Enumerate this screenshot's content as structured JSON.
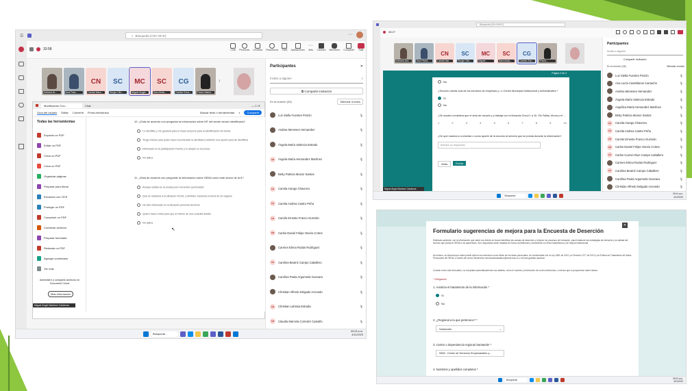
{
  "slide": {
    "accent_colors": [
      "#8dc63f",
      "#5a8f29",
      "#a9d76a"
    ]
  },
  "teams_call": {
    "search_placeholder": "Búsqueda (Ctrl+Alt+E)",
    "meeting_time": "33:58",
    "toolbar": {
      "chat": "Chat",
      "people": "Personas",
      "raise": "Levantar",
      "react": "Reaccionar",
      "view": "Vista",
      "apps": "Aplicaciones",
      "more": "Más",
      "camera": "Cámara",
      "mic": "Micrófono",
      "share": "Compartir",
      "leave": "Salir"
    },
    "tiles": [
      {
        "kind": "photo",
        "label": "Adriana Ar..."
      },
      {
        "kind": "photo",
        "label": "Ana Paul..."
      },
      {
        "initials": "CN",
        "label": "Camila Nara...",
        "bg": "#f7d6d2",
        "fg": "#a4262c"
      },
      {
        "initials": "SC",
        "label": "Sergio Cifu...",
        "bg": "#d9e6f5",
        "fg": "#2f5f98"
      },
      {
        "initials": "MC",
        "label": "Miguel Ángel M...",
        "bg": "#f4d8dc",
        "fg": "#a4262c"
      },
      {
        "initials": "SC",
        "label": "Sara Arias...",
        "bg": "#f7d6d2",
        "fg": "#a4262c"
      },
      {
        "initials": "CG",
        "label": "Camila Gonz...",
        "bg": "#d9e6f5",
        "fg": "#2f5f98"
      },
      {
        "kind": "photo",
        "label": "Paula Valent..."
      }
    ],
    "browser_tab": "Modificación Con...",
    "browser_tab2": "Chat",
    "pdf_menu": [
      "Guía del usuario",
      "Editar",
      "Convertir",
      "Firma electrónica"
    ],
    "pdf_search": "Buscar texto o herramientas",
    "pdf_share": "Compartir",
    "tools_title": "Todas las herramientas",
    "tools": [
      {
        "label": "Exportar un PDF",
        "color": "#c0392b"
      },
      {
        "label": "Editar un PDF",
        "color": "#8e44ad"
      },
      {
        "label": "Crear un PDF",
        "color": "#c0392b"
      },
      {
        "label": "Crear un PDF",
        "color": "#e74c3c"
      },
      {
        "label": "Organizar páginas",
        "color": "#27ae60"
      },
      {
        "label": "Preparar para firmar",
        "color": "#8e44ad"
      },
      {
        "label": "Escanear con OCR",
        "color": "#2980b9"
      },
      {
        "label": "Proteger un PDF",
        "color": "#2980b9"
      },
      {
        "label": "Comprimir un PDF",
        "color": "#c0392b"
      },
      {
        "label": "Combinar archivos",
        "color": "#d35400"
      },
      {
        "label": "Preparar formulario",
        "color": "#8e44ad"
      },
      {
        "label": "Redactar un PDF",
        "color": "#c0392b"
      },
      {
        "label": "Agregar comentario",
        "color": "#16a085"
      },
      {
        "label": "Ver más",
        "color": "#7f8c8d"
      }
    ],
    "upsell_text": "Administre y comparta archivos en Document Cloud",
    "more_info": "Más información",
    "presenter": "Miguel Ángel Martínez Cárdenas",
    "q1": "10. ¿Está de acuerdo con preguntar la información sobre MT del sector sector identificado?",
    "q1_options": [
      "Lo identifico y me gustaría para el mejor proyecto para la identificación de fuente",
      "Tengo interés para poder hacer recomendar la identidad y también una opción para de identificar",
      "Interesado en la participación Fuente y lo adopto no reconoce",
      "No aplica"
    ],
    "q2": "11. ¿Está de acuerdo con preguntar la información sobre SENA como este sector de la 6?",
    "q2_options": [
      "Aunque estaba en la escasa pero ha tenido oportunidad",
      "Que se relaciona a la situación SCGS, y también, haciendo el tema de los lugares",
      "He sido interesado en la situación personal del tema",
      "Quiero hacer entrar para que el interés de una consulta detalle",
      "No aplica"
    ],
    "participants_title": "Participantes",
    "invite_placeholder": "Invitar a alguien",
    "share_invite": "Compartir invitación",
    "in_meeting": "En la reunión (34)",
    "mute_all": "Silenciar a todos",
    "participants": [
      {
        "name": "Luz Stella Fuentes Pinzón",
        "photo": true
      },
      {
        "name": "Andrea Meneses Hernandez",
        "photo": true
      },
      {
        "name": "Ángela María Valencia Estrada",
        "photo": true
      },
      {
        "initials": "AH",
        "name": "Ángela María Hernandez Martínez"
      },
      {
        "name": "Betty Patricia Munoz Santos",
        "photo": true
      },
      {
        "initials": "CA",
        "name": "Camila Arango Chaverra"
      },
      {
        "initials": "CA",
        "name": "Camila Andrea Castro Peña"
      },
      {
        "initials": "CG",
        "name": "Camilo Ernesto Franco Guzmán"
      },
      {
        "initials": "CD",
        "name": "Carlos Daniel Felipe Osorio Cortes"
      },
      {
        "name": "Carmen Elena Rodas Rodríguez",
        "photo": true
      },
      {
        "initials": "CC",
        "name": "Carolina Beatriz Campo Caballero"
      },
      {
        "name": "Carolina Paola Argumedo Guevara",
        "photo": true
      },
      {
        "name": "Christian Alfredo Delgado Acevedo",
        "photo": true
      },
      {
        "initials": "CE",
        "name": "Christian Lahissa Estrada"
      },
      {
        "initials": "CD",
        "name": "Claudia Marcela Corredor Castaño"
      }
    ],
    "taskbar_search": "Búsqueda",
    "clock_time": "09:03 a.m.",
    "clock_date": "4/11/2023"
  },
  "teams_form": {
    "search_placeholder": "Búsqueda (Ctrl+Alt+E)",
    "meeting_time": "48:27",
    "tiles": [
      {
        "kind": "photo",
        "label": "Adriana Arango..."
      },
      {
        "kind": "photo",
        "label": "Ana Paula..."
      },
      {
        "initials": "CN",
        "label": "Camila Nara...",
        "bg": "#f7d6d2",
        "fg": "#a4262c"
      },
      {
        "initials": "SC",
        "label": "Sergio Cifu...",
        "bg": "#d9e6f5",
        "fg": "#2f5f98"
      },
      {
        "initials": "MC",
        "label": "Miguel...",
        "bg": "#f4d8dc",
        "fg": "#a4262c"
      },
      {
        "initials": "SC",
        "label": "Sara Arias...",
        "bg": "#f7d6d2",
        "fg": "#a4262c"
      },
      {
        "initials": "CG",
        "label": "Camila Gonzalez...",
        "bg": "#d9e6f5",
        "fg": "#2f5f98"
      },
      {
        "kind": "photo",
        "label": "Paula..."
      }
    ],
    "q_autoriza_opt": "Sí",
    "q_sector": "¿Sección cuenta cuál de los servicios de empresas y / o Centro Municipal Institucional y Administrativo *",
    "q_sector_opt": "Sí",
    "q_regional": "¿Se usuario considera que el área de usuario y y trabaja con el Amanda Cloud 1 a 10, Sin Fallas, Ahora y el Satisfecho, ahora?",
    "scale_numbers": [
      "1",
      "2",
      "3",
      "4",
      "5",
      "6",
      "7",
      "8",
      "9",
      "10"
    ],
    "q_comment": "¿De qué manera sí comentar o como aporte de la sección al servicio que se presta durante la información?",
    "comment_placeholder": "Escriba su respuesta",
    "back_btn": "Atrás",
    "next_btn": "Enviar",
    "page_label": "Página 3 de 3",
    "presenter": "Miguel Ángel Martínez Cárdenas",
    "participants_title": "Participantes",
    "invite_placeholder": "Invitar a alguien",
    "share_invite": "Compartir invitación",
    "in_meeting": "En la reunión (35)",
    "mute_all": "Silenciar a todos",
    "participants": [
      {
        "name": "Luz Stella Fuentes Pinzón",
        "photo": true
      },
      {
        "name": "Ana Lucía Castellanos Camacho",
        "photo": true
      },
      {
        "name": "Andrea Meneses Hernandez",
        "photo": true
      },
      {
        "name": "Ángela María Valencia Estrada",
        "photo": true
      },
      {
        "name": "Angélica María Hernandez Martínez",
        "photo": true
      },
      {
        "name": "Betty Patricia Munoz Santos",
        "photo": true
      },
      {
        "initials": "CA",
        "name": "Camila Arango Chaverra"
      },
      {
        "initials": "CA",
        "name": "Camila Andrea Castro Peña"
      },
      {
        "initials": "CG",
        "name": "Camilo Ernesto Franco Guzmán"
      },
      {
        "initials": "CD",
        "name": "Carlos Daniel Felipe Osorio Cortes"
      },
      {
        "initials": "CC",
        "name": "Carlos Cuervo Ruiz Campo Caballero"
      },
      {
        "name": "Carmen Elena Rodas Rodríguez",
        "photo": true
      },
      {
        "initials": "CC",
        "name": "Carolina Beatriz Campo Caballero"
      },
      {
        "name": "Carolina Paola Argumedo Guevara",
        "photo": true
      },
      {
        "name": "Christian Alfredo Delgado Acevedo",
        "photo": true
      }
    ],
    "taskbar_search": "Búsqueda",
    "clock_time": "09:14 a.m.",
    "clock_date": "4/11/2023"
  },
  "form": {
    "title": "Formulario sugerencias de mejora para la Encuesta de Deserción",
    "intro1": "Estimado aprendiz: con la información que usted nos brinde se busca identificar las causas de deserción y mejorar los procesos de formación, para fortalecer las estrategias de retención y la calidad del servicio que presta el SENA a los aprendices. Sus respuestas serán tratadas de forma confidencial y únicamente con fines estadísticos y de mejora institucional.",
    "intro2": "Así mismo, se informa que usted puede ejercer sus derechos como titular de los datos personales, de conformidad con la Ley 1581 de 2012 y el Decreto 1377 de 2013 y la Política de Tratamiento de Datos Personales del SENA, a través del correo electrónico servicioalciudadano@sena.edu.co o la línea gratuita nacional.",
    "intro3": "Cuando envíe este formulario, no recopilará automáticamente sus detalles, como el nombre y la dirección de correo electrónico, a menos que lo proporcione usted mismo.",
    "required_note": "* Obligatorio",
    "q1": "1. Autoriza el tratamiento de la información *",
    "q1_options": [
      "Sí",
      "No"
    ],
    "q2": "2. ¿Regional a la que pertenece? *",
    "q2_value": "Santander",
    "q3": "3. Centro o dependencia regional Santander *",
    "q3_value": "9308 - Centro de Servicios Empresariales y...",
    "q4": "4. Nombres y apellidos completos *",
    "taskbar_search": "Búsqueda",
    "clock_time": "09:20 a.m.",
    "clock_date": "4/11/2023"
  }
}
